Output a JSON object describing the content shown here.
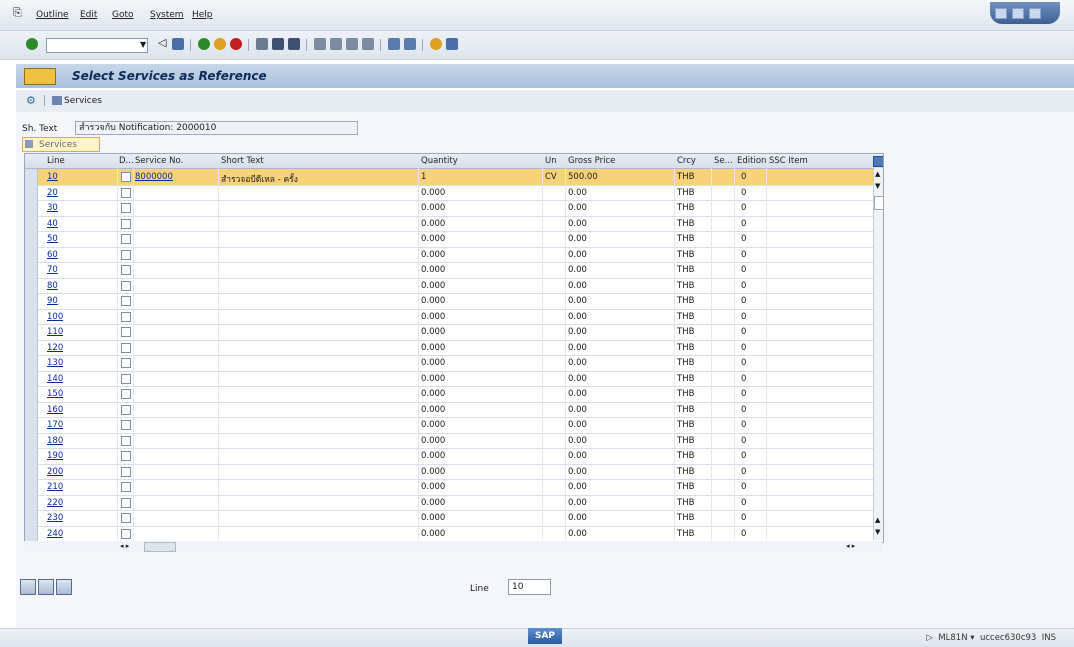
{
  "menu": {
    "items": [
      "Outline",
      "Edit",
      "Goto",
      "System",
      "Help"
    ]
  },
  "title": "Select Services as Reference",
  "app_toolbar": {
    "services_label": "Services"
  },
  "header": {
    "sh_text_label": "Sh. Text",
    "sh_text_value": "สำรวจกับ Notification: 2000010"
  },
  "tab": {
    "label": "Services"
  },
  "table": {
    "columns": [
      "Line",
      "D...",
      "Service No.",
      "Short Text",
      "Quantity",
      "Un",
      "Gross Price",
      "Crcy",
      "Se...",
      "Edition",
      "SSC Item"
    ],
    "rows": [
      {
        "line": "10",
        "service_no": "8000000",
        "short_text": "สำรวจอบีดีเหล - ครั้ง",
        "quantity": "1",
        "un": "CV",
        "gross_price": "500.00",
        "crcy": "THB",
        "edition": "0"
      },
      {
        "line": "20",
        "service_no": "",
        "short_text": "",
        "quantity": "0.000",
        "un": "",
        "gross_price": "0.00",
        "crcy": "THB",
        "edition": "0"
      },
      {
        "line": "30",
        "service_no": "",
        "short_text": "",
        "quantity": "0.000",
        "un": "",
        "gross_price": "0.00",
        "crcy": "THB",
        "edition": "0"
      },
      {
        "line": "40",
        "service_no": "",
        "short_text": "",
        "quantity": "0.000",
        "un": "",
        "gross_price": "0.00",
        "crcy": "THB",
        "edition": "0"
      },
      {
        "line": "50",
        "service_no": "",
        "short_text": "",
        "quantity": "0.000",
        "un": "",
        "gross_price": "0.00",
        "crcy": "THB",
        "edition": "0"
      },
      {
        "line": "60",
        "service_no": "",
        "short_text": "",
        "quantity": "0.000",
        "un": "",
        "gross_price": "0.00",
        "crcy": "THB",
        "edition": "0"
      },
      {
        "line": "70",
        "service_no": "",
        "short_text": "",
        "quantity": "0.000",
        "un": "",
        "gross_price": "0.00",
        "crcy": "THB",
        "edition": "0"
      },
      {
        "line": "80",
        "service_no": "",
        "short_text": "",
        "quantity": "0.000",
        "un": "",
        "gross_price": "0.00",
        "crcy": "THB",
        "edition": "0"
      },
      {
        "line": "90",
        "service_no": "",
        "short_text": "",
        "quantity": "0.000",
        "un": "",
        "gross_price": "0.00",
        "crcy": "THB",
        "edition": "0"
      },
      {
        "line": "100",
        "service_no": "",
        "short_text": "",
        "quantity": "0.000",
        "un": "",
        "gross_price": "0.00",
        "crcy": "THB",
        "edition": "0"
      },
      {
        "line": "110",
        "service_no": "",
        "short_text": "",
        "quantity": "0.000",
        "un": "",
        "gross_price": "0.00",
        "crcy": "THB",
        "edition": "0"
      },
      {
        "line": "120",
        "service_no": "",
        "short_text": "",
        "quantity": "0.000",
        "un": "",
        "gross_price": "0.00",
        "crcy": "THB",
        "edition": "0"
      },
      {
        "line": "130",
        "service_no": "",
        "short_text": "",
        "quantity": "0.000",
        "un": "",
        "gross_price": "0.00",
        "crcy": "THB",
        "edition": "0"
      },
      {
        "line": "140",
        "service_no": "",
        "short_text": "",
        "quantity": "0.000",
        "un": "",
        "gross_price": "0.00",
        "crcy": "THB",
        "edition": "0"
      },
      {
        "line": "150",
        "service_no": "",
        "short_text": "",
        "quantity": "0.000",
        "un": "",
        "gross_price": "0.00",
        "crcy": "THB",
        "edition": "0"
      },
      {
        "line": "160",
        "service_no": "",
        "short_text": "",
        "quantity": "0.000",
        "un": "",
        "gross_price": "0.00",
        "crcy": "THB",
        "edition": "0"
      },
      {
        "line": "170",
        "service_no": "",
        "short_text": "",
        "quantity": "0.000",
        "un": "",
        "gross_price": "0.00",
        "crcy": "THB",
        "edition": "0"
      },
      {
        "line": "180",
        "service_no": "",
        "short_text": "",
        "quantity": "0.000",
        "un": "",
        "gross_price": "0.00",
        "crcy": "THB",
        "edition": "0"
      },
      {
        "line": "190",
        "service_no": "",
        "short_text": "",
        "quantity": "0.000",
        "un": "",
        "gross_price": "0.00",
        "crcy": "THB",
        "edition": "0"
      },
      {
        "line": "200",
        "service_no": "",
        "short_text": "",
        "quantity": "0.000",
        "un": "",
        "gross_price": "0.00",
        "crcy": "THB",
        "edition": "0"
      },
      {
        "line": "210",
        "service_no": "",
        "short_text": "",
        "quantity": "0.000",
        "un": "",
        "gross_price": "0.00",
        "crcy": "THB",
        "edition": "0"
      },
      {
        "line": "220",
        "service_no": "",
        "short_text": "",
        "quantity": "0.000",
        "un": "",
        "gross_price": "0.00",
        "crcy": "THB",
        "edition": "0"
      },
      {
        "line": "230",
        "service_no": "",
        "short_text": "",
        "quantity": "0.000",
        "un": "",
        "gross_price": "0.00",
        "crcy": "THB",
        "edition": "0"
      },
      {
        "line": "240",
        "service_no": "",
        "short_text": "",
        "quantity": "0.000",
        "un": "",
        "gross_price": "0.00",
        "crcy": "THB",
        "edition": "0"
      }
    ]
  },
  "footer": {
    "line_label": "Line",
    "line_value": "10"
  },
  "status": {
    "sap_logo": "SAP",
    "transaction": "ML81N",
    "server": "uccec630c93",
    "mode": "INS"
  },
  "colors": {
    "selected_row": "#f8d27a",
    "title_text": "#0b2a55",
    "link": "#0a2a9a"
  }
}
